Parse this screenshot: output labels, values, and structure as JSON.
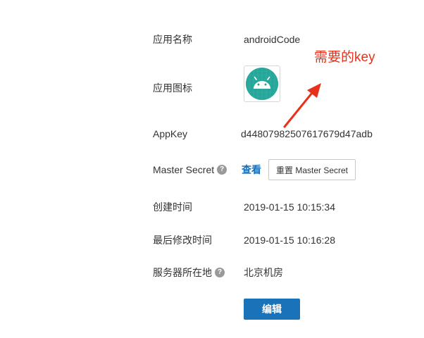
{
  "fields": {
    "app_name": {
      "label": "应用名称",
      "value": "androidCode"
    },
    "app_icon": {
      "label": "应用图标",
      "icon": "android-icon",
      "icon_bg": "#26a69a"
    },
    "app_key": {
      "label": "AppKey",
      "value": "d44807982507617679d47adb"
    },
    "master_secret": {
      "label": "Master Secret",
      "help": "?",
      "view_label": "查看",
      "reset_label": "重置 Master Secret"
    },
    "created_time": {
      "label": "创建时间",
      "value": "2019-01-15 10:15:34"
    },
    "modified_time": {
      "label": "最后修改时间",
      "value": "2019-01-15 10:16:28"
    },
    "server_location": {
      "label": "服务器所在地",
      "help": "?",
      "value": "北京机房"
    }
  },
  "edit_button": {
    "label": "编辑"
  },
  "annotation": {
    "text": "需要的key",
    "color": "#e8311b"
  },
  "colors": {
    "link": "#1a6eb8",
    "primary_button": "#1a73b8"
  }
}
